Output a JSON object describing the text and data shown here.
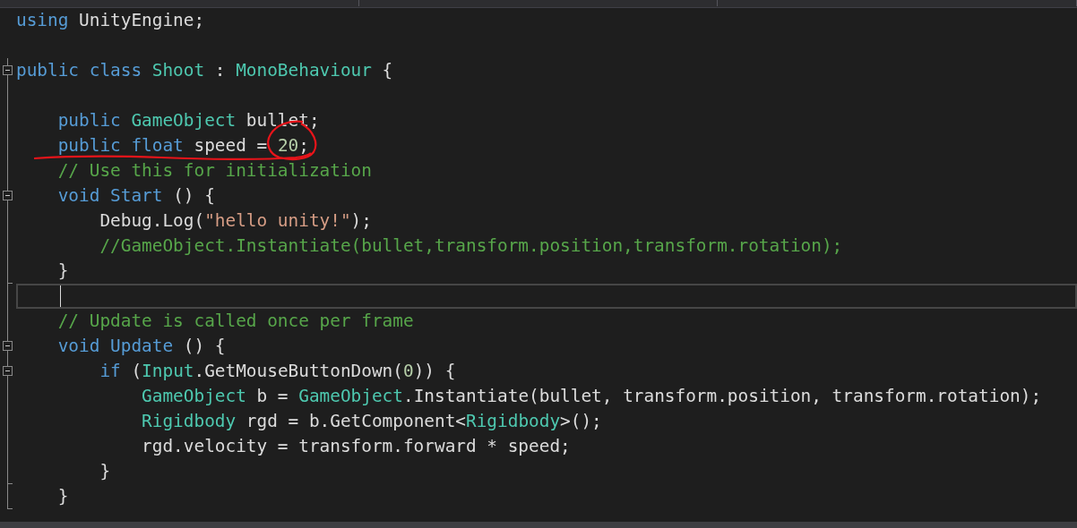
{
  "editor": {
    "lines": [
      {
        "collapsible": false,
        "fold_end": false,
        "current": false,
        "tokens": [
          {
            "kind": "kw",
            "text": "using "
          },
          {
            "kind": "plain",
            "text": "UnityEngine;"
          }
        ]
      },
      {
        "collapsible": false,
        "fold_end": false,
        "current": false
      },
      {
        "collapsible": true,
        "fold_end": false,
        "current": false,
        "tokens": [
          {
            "kind": "kw",
            "text": "public class "
          },
          {
            "kind": "type",
            "text": "Shoot"
          },
          {
            "kind": "plain",
            "text": " : "
          },
          {
            "kind": "type",
            "text": "MonoBehaviour"
          },
          {
            "kind": "plain",
            "text": " {"
          }
        ]
      },
      {
        "collapsible": false,
        "fold_end": false,
        "current": false
      },
      {
        "collapsible": false,
        "fold_end": false,
        "current": false,
        "tokens": [
          {
            "kind": "kw",
            "text": "    public "
          },
          {
            "kind": "type",
            "text": "GameObject"
          },
          {
            "kind": "plain",
            "text": " bullet;"
          }
        ]
      },
      {
        "collapsible": false,
        "fold_end": false,
        "current": false,
        "tokens": [
          {
            "kind": "kw",
            "text": "    public float"
          },
          {
            "kind": "plain",
            "text": " speed = "
          },
          {
            "kind": "number",
            "text": "20"
          },
          {
            "kind": "plain",
            "text": ";"
          }
        ]
      },
      {
        "collapsible": false,
        "fold_end": false,
        "current": false,
        "tokens": [
          {
            "kind": "comment",
            "text": "    // Use this for initialization"
          }
        ]
      },
      {
        "collapsible": true,
        "fold_end": false,
        "current": false,
        "tokens": [
          {
            "kind": "kw",
            "text": "    void Start"
          },
          {
            "kind": "plain",
            "text": " () {"
          }
        ]
      },
      {
        "collapsible": false,
        "fold_end": false,
        "current": false,
        "tokens": [
          {
            "kind": "plain",
            "text": "        Debug.Log("
          },
          {
            "kind": "string",
            "text": "\"hello unity!\""
          },
          {
            "kind": "plain",
            "text": ");"
          }
        ]
      },
      {
        "collapsible": false,
        "fold_end": false,
        "current": false,
        "tokens": [
          {
            "kind": "comment",
            "text": "        //GameObject.Instantiate(bullet,transform.position,transform.rotation);"
          }
        ]
      },
      {
        "collapsible": false,
        "fold_end": true,
        "current": false,
        "tokens": [
          {
            "kind": "plain",
            "text": "    }"
          }
        ]
      },
      {
        "collapsible": false,
        "fold_end": false,
        "current": true
      },
      {
        "collapsible": false,
        "fold_end": false,
        "current": false,
        "tokens": [
          {
            "kind": "comment",
            "text": "    // Update is called once per frame"
          }
        ]
      },
      {
        "collapsible": true,
        "fold_end": false,
        "current": false,
        "tokens": [
          {
            "kind": "kw",
            "text": "    void Update"
          },
          {
            "kind": "plain",
            "text": " () {"
          }
        ]
      },
      {
        "collapsible": true,
        "fold_end": false,
        "current": false,
        "tokens": [
          {
            "kind": "kw",
            "text": "        if"
          },
          {
            "kind": "plain",
            "text": " ("
          },
          {
            "kind": "type",
            "text": "Input"
          },
          {
            "kind": "plain",
            "text": ".GetMouseButtonDown("
          },
          {
            "kind": "number",
            "text": "0"
          },
          {
            "kind": "plain",
            "text": ")) {"
          }
        ]
      },
      {
        "collapsible": false,
        "fold_end": false,
        "current": false,
        "tokens": [
          {
            "kind": "type",
            "text": "            GameObject"
          },
          {
            "kind": "plain",
            "text": " b = "
          },
          {
            "kind": "type",
            "text": "GameObject"
          },
          {
            "kind": "plain",
            "text": ".Instantiate(bullet, transform.position, transform.rotation);"
          }
        ]
      },
      {
        "collapsible": false,
        "fold_end": false,
        "current": false,
        "tokens": [
          {
            "kind": "type",
            "text": "            Rigidbody"
          },
          {
            "kind": "plain",
            "text": " rgd = b.GetComponent<"
          },
          {
            "kind": "type",
            "text": "Rigidbody"
          },
          {
            "kind": "plain",
            "text": ">();"
          }
        ]
      },
      {
        "collapsible": false,
        "fold_end": false,
        "current": false,
        "tokens": [
          {
            "kind": "plain",
            "text": "            rgd.velocity = transform.forward * speed;"
          }
        ]
      },
      {
        "collapsible": false,
        "fold_end": true,
        "current": false,
        "tokens": [
          {
            "kind": "plain",
            "text": "        }"
          }
        ]
      },
      {
        "collapsible": false,
        "fold_end": true,
        "current": false,
        "tokens": [
          {
            "kind": "plain",
            "text": "    }"
          }
        ]
      }
    ]
  }
}
